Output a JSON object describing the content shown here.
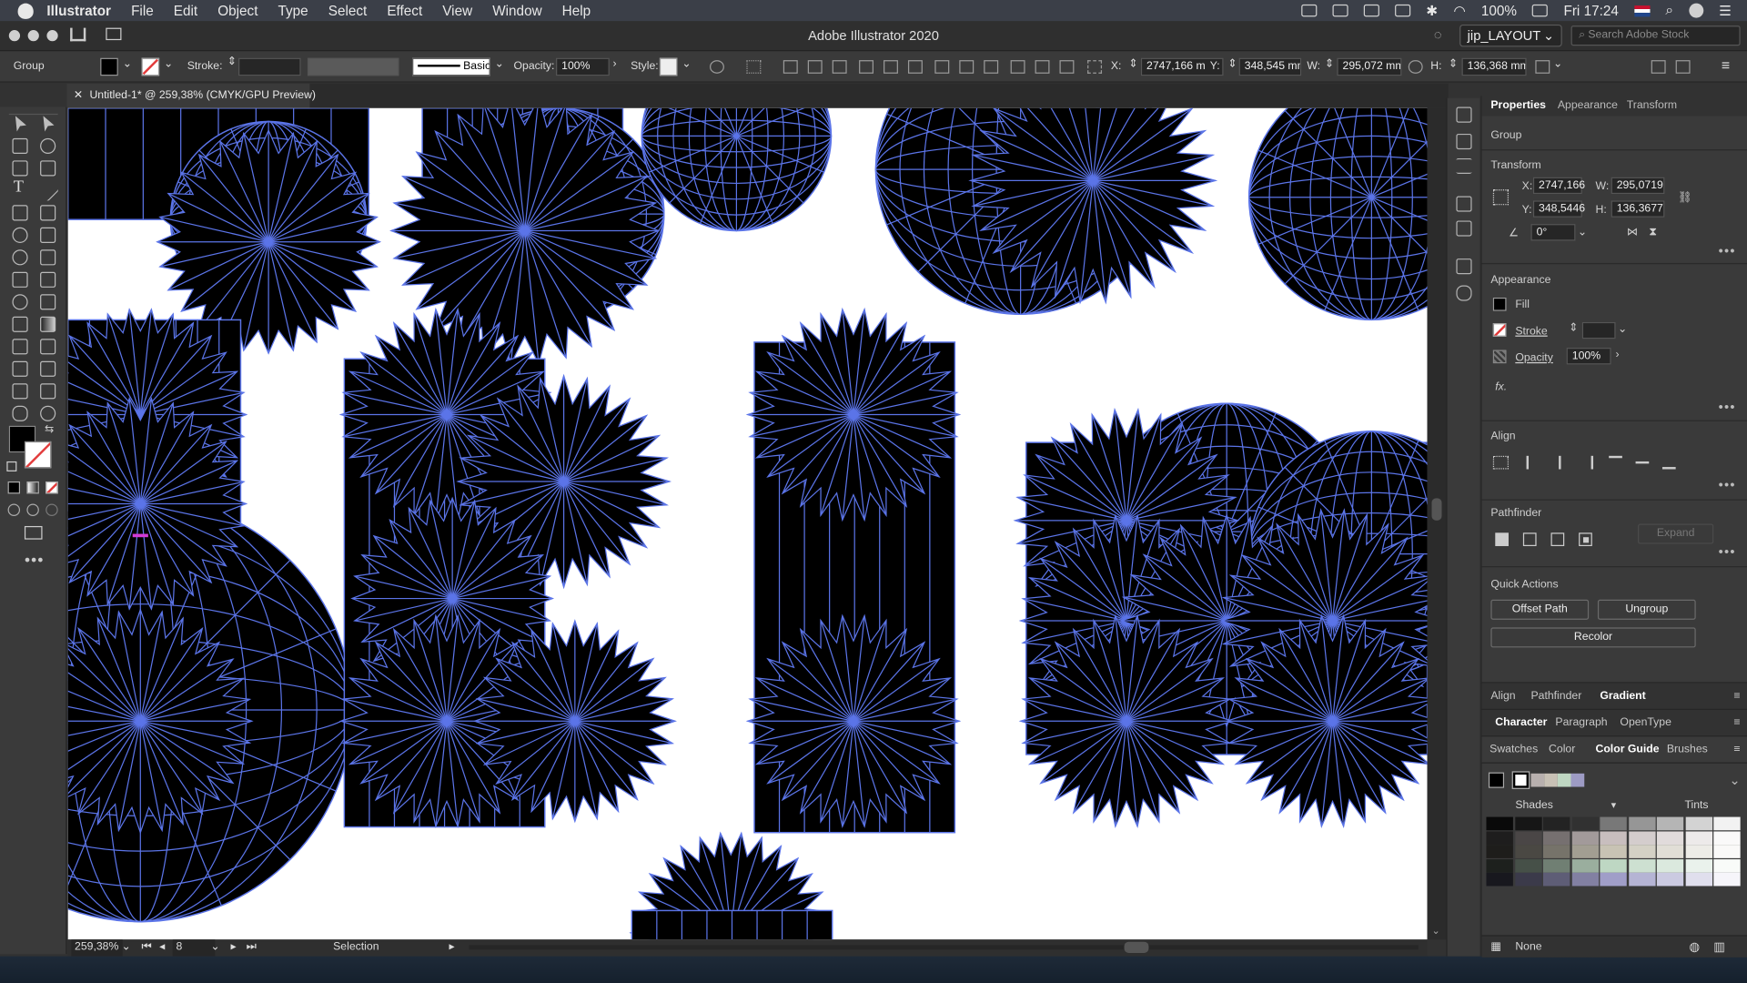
{
  "menubar": {
    "app": "Illustrator",
    "items": [
      "File",
      "Edit",
      "Object",
      "Type",
      "Select",
      "Effect",
      "View",
      "Window",
      "Help"
    ],
    "battery": "100%",
    "clock": "Fri 17:24"
  },
  "window": {
    "title": "Adobe Illustrator 2020",
    "workspace": "jip_LAYOUT",
    "stock_placeholder": "Search Adobe Stock"
  },
  "control_bar": {
    "selection_type": "Group",
    "stroke_label": "Stroke:",
    "brush_label": "Basic",
    "opacity_label": "Opacity:",
    "opacity_value": "100%",
    "style_label": "Style:",
    "x_label": "X:",
    "x_value": "2747,166 m",
    "y_label": "Y:",
    "y_value": "348,545 mm",
    "w_label": "W:",
    "w_value": "295,072 mm",
    "h_label": "H:",
    "h_value": "136,368 mm"
  },
  "document": {
    "tab_title": "Untitled-1* @ 259,38% (CMYK/GPU Preview)",
    "zoom": "259,38%",
    "artboard": "8",
    "status": "Selection"
  },
  "properties": {
    "tabs": [
      "Properties",
      "Appearance",
      "Transform"
    ],
    "selection": "Group",
    "transform_title": "Transform",
    "x_label": "X:",
    "x": "2747,166",
    "y_label": "Y:",
    "y": "348,5446",
    "w_label": "W:",
    "w": "295,0719",
    "h_label": "H:",
    "h": "136,3677",
    "angle": "0°",
    "appearance_title": "Appearance",
    "fill_label": "Fill",
    "stroke_label": "Stroke",
    "opacity_label": "Opacity",
    "opacity_value": "100%",
    "fx_label": "fx.",
    "align_title": "Align",
    "pathfinder_title": "Pathfinder",
    "expand_label": "Expand",
    "quick_actions_title": "Quick Actions",
    "offset_path": "Offset Path",
    "ungroup": "Ungroup",
    "recolor": "Recolor"
  },
  "bottom_panels": {
    "row1": [
      "Align",
      "Pathfinder",
      "Gradient"
    ],
    "row2": [
      "Character",
      "Paragraph",
      "OpenType"
    ],
    "row3": [
      "Swatches",
      "Color",
      "Color Guide",
      "Brushes"
    ],
    "shades_label": "Shades",
    "tints_label": "Tints",
    "none_label": "None"
  },
  "colors": {
    "art_fill": "#000000",
    "selection_blue": "#5b74e8",
    "accent_red": "#e23b3b",
    "guide_swatches": [
      "#b8b0ae",
      "#c8c1b5",
      "#bfd7c2",
      "#9d9bc4"
    ]
  }
}
